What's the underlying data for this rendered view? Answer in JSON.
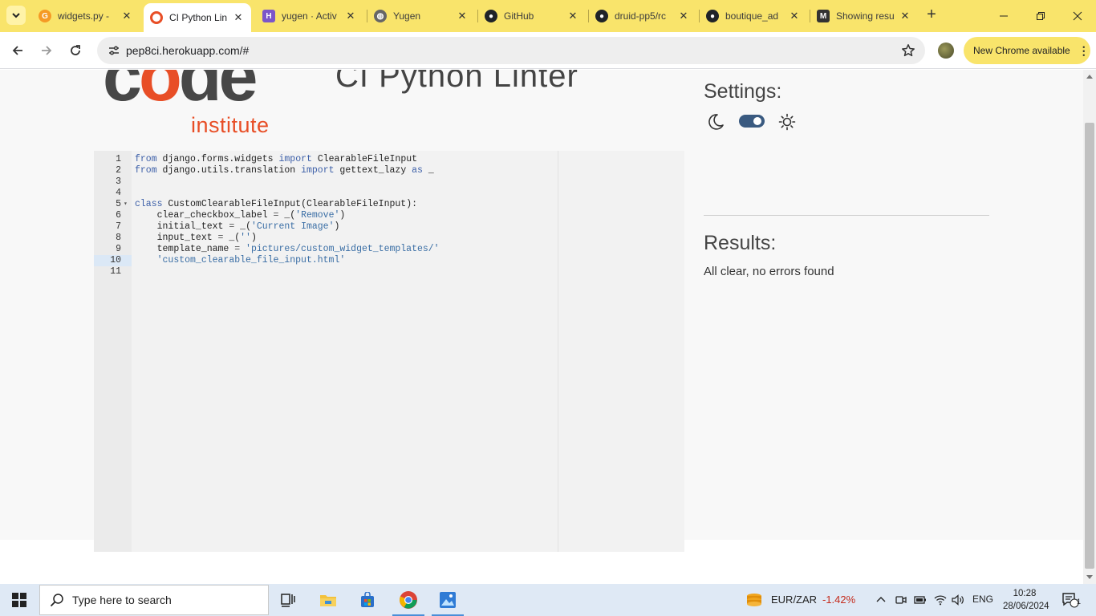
{
  "browser": {
    "tabs": [
      {
        "title": "widgets.py -",
        "favicon": "gitpod-icon",
        "favicon_color": "#f59a25"
      },
      {
        "title": "CI Python Lin",
        "favicon": "code-institute-icon",
        "favicon_color": "#e84e26",
        "active": true
      },
      {
        "title": "yugen · Activ",
        "favicon": "heroku-icon",
        "favicon_color": "#7b56c9"
      },
      {
        "title": "Yugen",
        "favicon": "globe-icon",
        "favicon_color": "#666666"
      },
      {
        "title": "GitHub",
        "favicon": "github-icon",
        "favicon_color": "#1f2328"
      },
      {
        "title": "druid-pp5/rc",
        "favicon": "github-icon",
        "favicon_color": "#1f2328"
      },
      {
        "title": "boutique_ad",
        "favicon": "github-icon",
        "favicon_color": "#1f2328"
      },
      {
        "title": "Showing resu",
        "favicon": "m-icon",
        "favicon_color": "#333333"
      }
    ],
    "url": "pep8ci.herokuapp.com/#",
    "update_pill": "New Chrome available"
  },
  "page": {
    "logo_word": "code",
    "logo_sub": "institute",
    "title": "CI Python Linter",
    "editor": {
      "lines": [
        {
          "n": "1",
          "text": "from django.forms.widgets import ClearableFileInput"
        },
        {
          "n": "2",
          "text": "from django.utils.translation import gettext_lazy as _"
        },
        {
          "n": "3",
          "text": ""
        },
        {
          "n": "4",
          "text": ""
        },
        {
          "n": "5",
          "text": "class CustomClearableFileInput(ClearableFileInput):",
          "fold": true
        },
        {
          "n": "6",
          "text": "    clear_checkbox_label = _('Remove')"
        },
        {
          "n": "7",
          "text": "    initial_text = _('Current Image')"
        },
        {
          "n": "8",
          "text": "    input_text = _('')"
        },
        {
          "n": "9",
          "text": "    template_name = 'pictures/custom_widget_templates/'"
        },
        {
          "n": "10",
          "text": "    'custom_clearable_file_input.html'",
          "active": true
        },
        {
          "n": "11",
          "text": ""
        }
      ]
    },
    "settings_title": "Settings:",
    "results_title": "Results:",
    "results_text": "All clear, no errors found",
    "theme_toggle_on": true
  },
  "taskbar": {
    "search_placeholder": "Type here to search",
    "ticker": "EUR/ZAR",
    "ticker_change": "-1.42%",
    "ticker_change_color": "#c42b1c",
    "lang": "ENG",
    "time": "10:28",
    "date": "28/06/2024",
    "notification_count": "1"
  }
}
